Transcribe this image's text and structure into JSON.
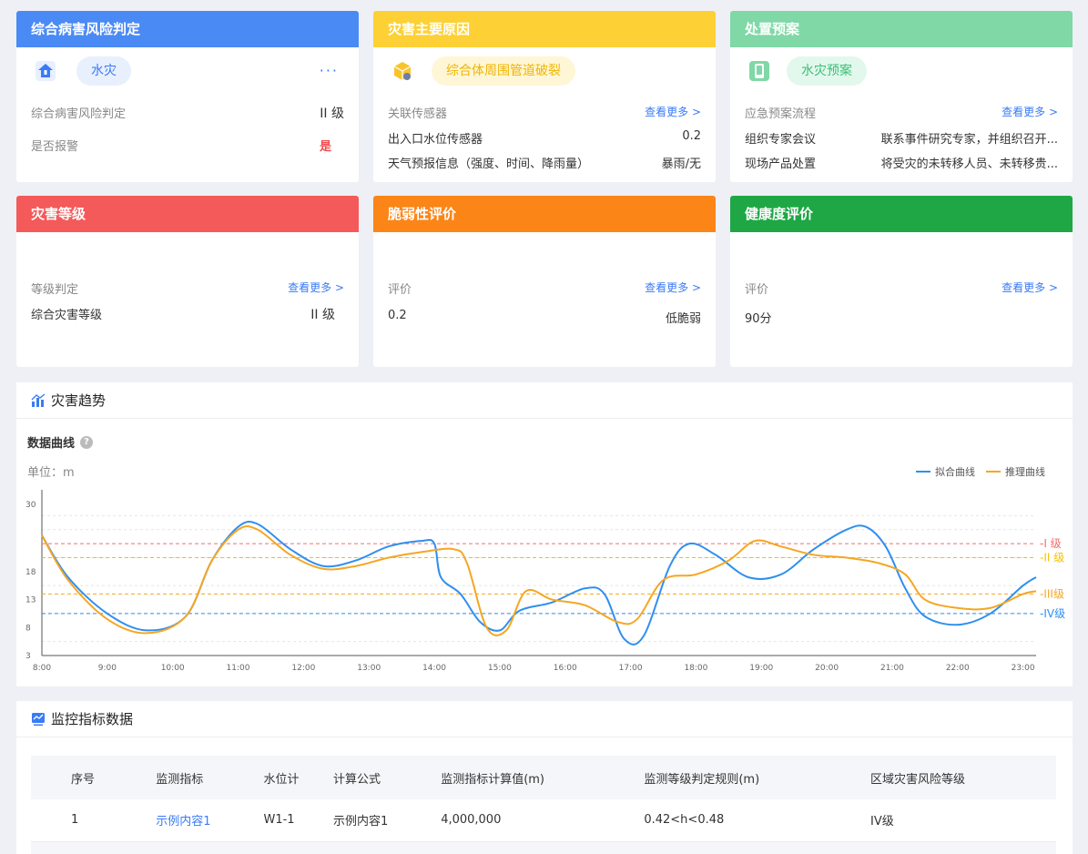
{
  "risk": {
    "title": "综合病害风险判定",
    "tag": "水灾",
    "more_dots": "···",
    "rows": [
      {
        "label": "综合病害风险判定",
        "value": "II 级"
      },
      {
        "label": "是否报警",
        "value": "是"
      }
    ]
  },
  "cause": {
    "title": "灾害主要原因",
    "tag": "综合体周围管道破裂",
    "more": "查看更多 >",
    "rows": [
      {
        "label": "关联传感器",
        "value": ""
      },
      {
        "label": "出入口水位传感器",
        "value": "0.2"
      },
      {
        "label": "天气预报信息（强度、时间、降雨量）",
        "value": "暴雨/无"
      }
    ]
  },
  "plan": {
    "title": "处置预案",
    "tag": "水灾预案",
    "more": "查看更多 >",
    "rows": [
      {
        "label": "应急预案流程",
        "value": ""
      },
      {
        "label": "组织专家会议",
        "value": "联系事件研究专家，并组织召开..."
      },
      {
        "label": "现场产品处置",
        "value": "将受灾的未转移人员、未转移贵..."
      }
    ]
  },
  "level": {
    "title": "灾害等级",
    "more": "查看更多 >",
    "rows": [
      {
        "label": "等级判定",
        "value": ""
      },
      {
        "label": "综合灾害等级",
        "value": "II 级"
      }
    ]
  },
  "vuln": {
    "title": "脆弱性评价",
    "more": "查看更多 >",
    "rows": [
      {
        "label": "评价",
        "value": ""
      },
      {
        "label": "0.2",
        "value": "低脆弱"
      }
    ]
  },
  "health": {
    "title": "健康度评价",
    "more": "查看更多 >",
    "rows": [
      {
        "label": "评价",
        "value": ""
      },
      {
        "label": "90分",
        "value": ""
      }
    ]
  },
  "trend": {
    "title": "灾害趋势",
    "subtitle": "数据曲线",
    "unit": "单位：m"
  },
  "colors": {
    "blue": "#4a8af4",
    "yellow": "#fdd135",
    "green": "#7fd8a6",
    "red": "#f45a5a",
    "orange": "#fc8518",
    "darkgreen": "#1fa745",
    "fit": "#2f8ff0",
    "infer": "#f5a623"
  },
  "chart_data": {
    "type": "line",
    "x": [
      "8:00",
      "9:00",
      "10:00",
      "11:00",
      "12:00",
      "13:00",
      "14:00",
      "15:00",
      "16:00",
      "17:00",
      "18:00",
      "19:00",
      "20:00",
      "21:00",
      "22:00",
      "23:00"
    ],
    "ylim": [
      3,
      31
    ],
    "yticks": [
      3,
      8,
      13,
      18,
      30
    ],
    "series": [
      {
        "name": "拟合曲线",
        "points": [
          [
            8.0,
            24.5
          ],
          [
            8.4,
            17.0
          ],
          [
            9.0,
            10.5
          ],
          [
            9.6,
            7.5
          ],
          [
            10.2,
            10.0
          ],
          [
            10.6,
            20.0
          ],
          [
            11.0,
            26.0
          ],
          [
            11.3,
            26.5
          ],
          [
            11.8,
            22.0
          ],
          [
            12.3,
            19.0
          ],
          [
            12.8,
            20.0
          ],
          [
            13.3,
            22.5
          ],
          [
            13.8,
            23.5
          ],
          [
            14.0,
            23.0
          ],
          [
            14.1,
            17.0
          ],
          [
            14.4,
            14.0
          ],
          [
            14.7,
            9.0
          ],
          [
            15.0,
            7.5
          ],
          [
            15.3,
            11.0
          ],
          [
            15.8,
            12.5
          ],
          [
            16.3,
            15.0
          ],
          [
            16.6,
            14.0
          ],
          [
            16.9,
            6.0
          ],
          [
            17.2,
            6.5
          ],
          [
            17.6,
            19.0
          ],
          [
            17.9,
            23.0
          ],
          [
            18.3,
            21.0
          ],
          [
            18.8,
            17.0
          ],
          [
            19.3,
            17.5
          ],
          [
            19.8,
            22.0
          ],
          [
            20.3,
            25.5
          ],
          [
            20.6,
            26.0
          ],
          [
            20.9,
            22.5
          ],
          [
            21.2,
            15.0
          ],
          [
            21.5,
            10.0
          ],
          [
            22.0,
            8.5
          ],
          [
            22.5,
            10.5
          ],
          [
            23.0,
            15.5
          ],
          [
            23.2,
            17.0
          ]
        ]
      },
      {
        "name": "推理曲线",
        "points": [
          [
            8.0,
            24.5
          ],
          [
            8.4,
            16.5
          ],
          [
            9.0,
            9.5
          ],
          [
            9.6,
            7.0
          ],
          [
            10.2,
            10.0
          ],
          [
            10.6,
            20.0
          ],
          [
            11.0,
            25.5
          ],
          [
            11.3,
            25.5
          ],
          [
            11.8,
            21.0
          ],
          [
            12.3,
            18.5
          ],
          [
            12.8,
            19.0
          ],
          [
            13.3,
            20.5
          ],
          [
            13.8,
            21.5
          ],
          [
            14.3,
            22.0
          ],
          [
            14.5,
            19.5
          ],
          [
            14.8,
            8.0
          ],
          [
            15.1,
            7.5
          ],
          [
            15.4,
            14.5
          ],
          [
            15.8,
            13.0
          ],
          [
            16.3,
            12.0
          ],
          [
            16.8,
            9.0
          ],
          [
            17.1,
            9.5
          ],
          [
            17.5,
            16.5
          ],
          [
            18.0,
            17.5
          ],
          [
            18.5,
            20.0
          ],
          [
            18.9,
            23.5
          ],
          [
            19.3,
            22.5
          ],
          [
            19.8,
            21.0
          ],
          [
            20.3,
            20.5
          ],
          [
            20.8,
            19.5
          ],
          [
            21.2,
            17.5
          ],
          [
            21.5,
            13.0
          ],
          [
            22.0,
            11.5
          ],
          [
            22.5,
            11.5
          ],
          [
            23.0,
            14.0
          ],
          [
            23.2,
            14.5
          ]
        ]
      }
    ],
    "thresholds": [
      {
        "label": "I 级",
        "value": 23.0,
        "color": "#f26d6d"
      },
      {
        "label": "II 级",
        "value": 20.5,
        "color": "#f5c100"
      },
      {
        "label": "III级",
        "value": 14.0,
        "color": "#f5a623"
      },
      {
        "label": "IV级",
        "value": 10.5,
        "color": "#2f8ff0"
      }
    ],
    "legend": "top-right"
  },
  "monitor": {
    "title": "监控指标数据",
    "columns": [
      "序号",
      "监测指标",
      "水位计",
      "计算公式",
      "监测指标计算值(m)",
      "监测等级判定规则(m)",
      "区域灾害风险等级"
    ],
    "rows": [
      [
        "1",
        "示例内容1",
        "W1-1",
        "示例内容1",
        "4,000,000",
        "0.42<h<0.48",
        "IV级"
      ]
    ]
  }
}
